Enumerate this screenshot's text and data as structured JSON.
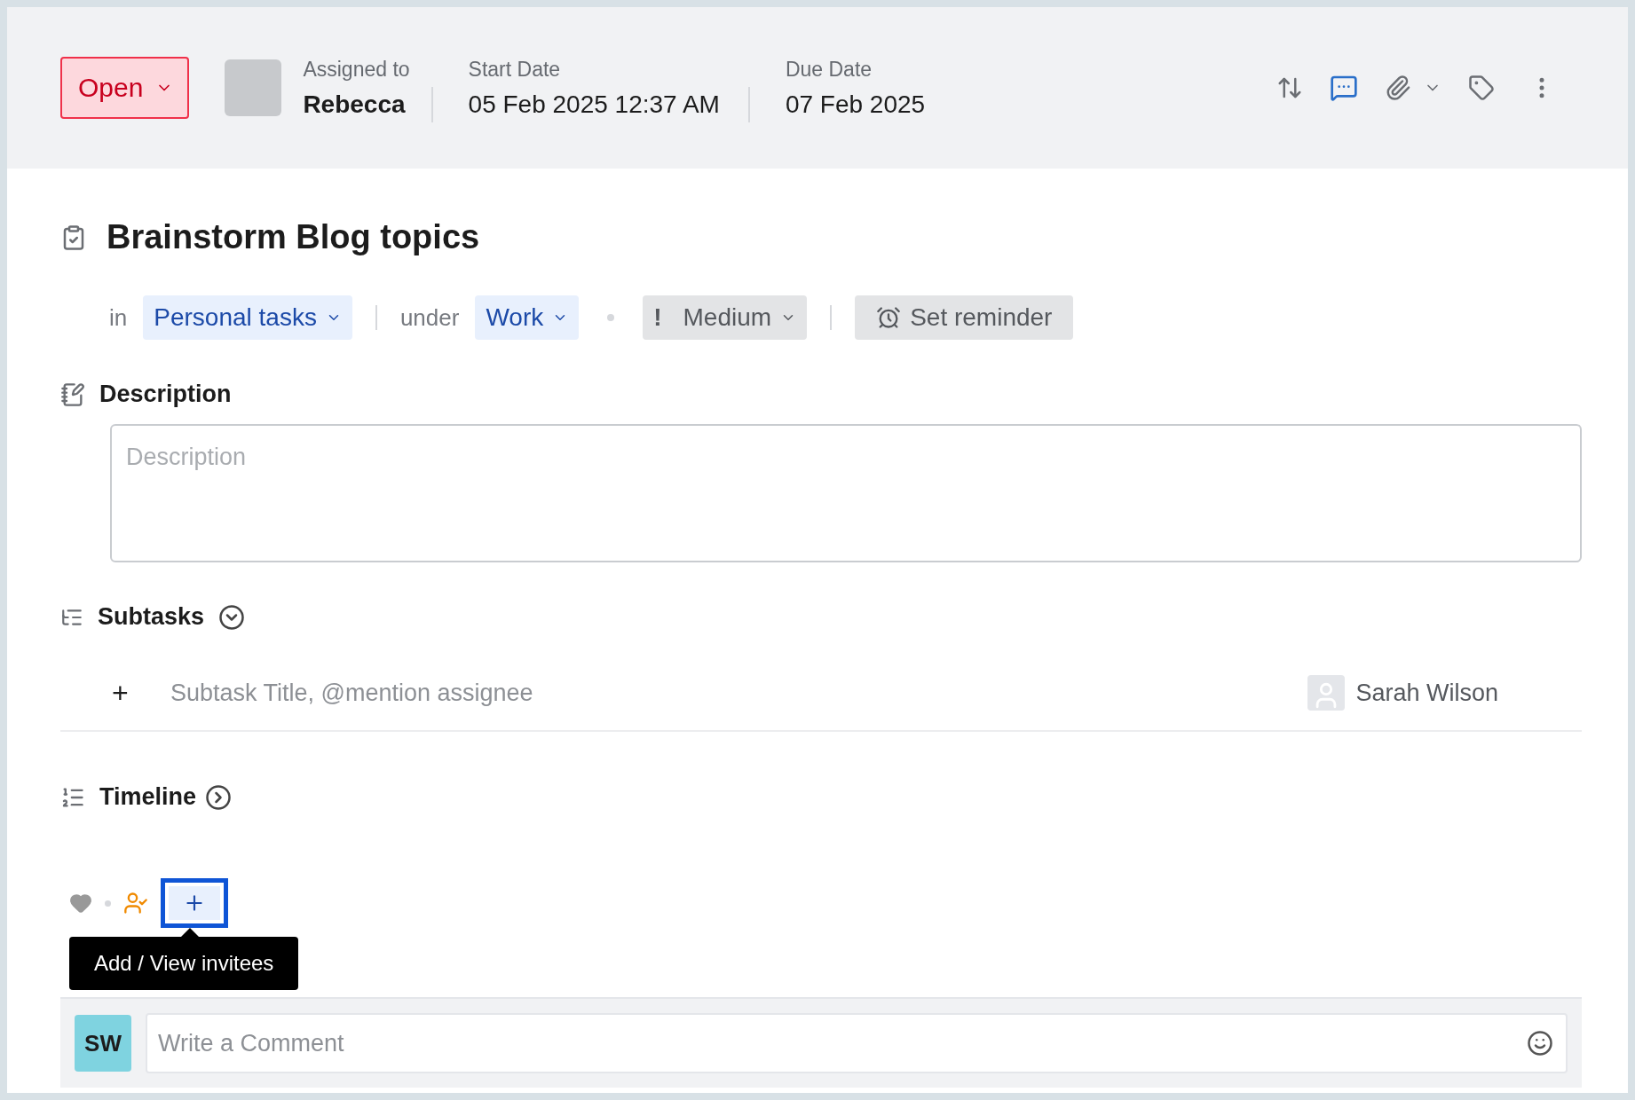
{
  "status": {
    "label": "Open"
  },
  "assignee": {
    "label": "Assigned to",
    "name": "Rebecca"
  },
  "start_date": {
    "label": "Start Date",
    "value": "05 Feb 2025 12:37 AM"
  },
  "due_date": {
    "label": "Due Date",
    "value": "07 Feb 2025"
  },
  "task": {
    "title": "Brainstorm Blog topics"
  },
  "meta": {
    "in_label": "in",
    "list": "Personal tasks",
    "under_label": "under",
    "category": "Work",
    "priority_mark": "!",
    "priority": "Medium",
    "reminder": "Set reminder"
  },
  "description": {
    "heading": "Description",
    "placeholder": "Description"
  },
  "subtasks": {
    "heading": "Subtasks",
    "add": "+",
    "placeholder": "Subtask Title, @mention assignee",
    "assignee": "Sarah Wilson"
  },
  "timeline": {
    "heading": "Timeline"
  },
  "comment": {
    "tooltip": "Add / View invitees",
    "avatar": "SW",
    "placeholder": "Write a Comment"
  }
}
